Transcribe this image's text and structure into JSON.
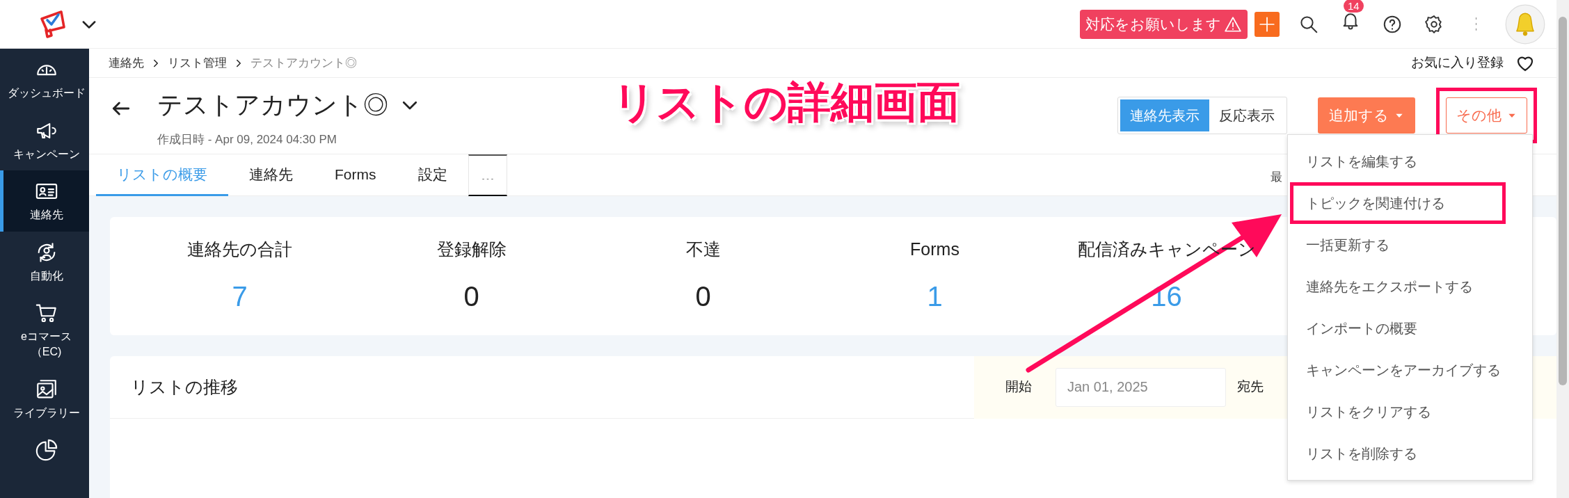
{
  "app_header": {
    "alert_button": "対応をお願いします",
    "notification_count": "14"
  },
  "sidebar": {
    "items": [
      {
        "label": "ダッシュボード",
        "kind": "gauge",
        "selected": false
      },
      {
        "label": "キャンペーン",
        "kind": "megaphone",
        "selected": false
      },
      {
        "label": "連絡先",
        "kind": "card",
        "selected": true
      },
      {
        "label": "自動化",
        "kind": "automation",
        "selected": false
      },
      {
        "label": "eコマース（EC)",
        "kind": "cart",
        "selected": false
      },
      {
        "label": "ライブラリー",
        "kind": "images",
        "selected": false
      },
      {
        "kind": "pie",
        "selected": false
      }
    ]
  },
  "breadcrumb": [
    {
      "label": "連絡先",
      "current": false
    },
    {
      "label": "リスト管理",
      "current": false
    },
    {
      "label": "テストアカウント◎",
      "current": true
    }
  ],
  "favorite": {
    "label": "お気に入り登録"
  },
  "page": {
    "title": "テストアカウント◎",
    "created": "作成日時 - Apr 09, 2024 04:30 PM"
  },
  "view_toggle": [
    {
      "label": "連絡先表示",
      "selected": true
    },
    {
      "label": "反応表示",
      "selected": false
    }
  ],
  "add_button": {
    "label": "追加する"
  },
  "more_button": {
    "label": "その他",
    "annotated": true
  },
  "tabs": [
    {
      "label": "リストの概要",
      "selected": true
    },
    {
      "label": "連絡先",
      "selected": false
    },
    {
      "label": "Forms",
      "selected": false
    },
    {
      "label": "設定",
      "selected": false
    }
  ],
  "tab_bar_note": "最",
  "stats": [
    {
      "label": "連絡先の合計",
      "value": "7",
      "link": true
    },
    {
      "label": "登録解除",
      "value": "0",
      "link": false
    },
    {
      "label": "不達",
      "value": "0",
      "link": false
    },
    {
      "label": "Forms",
      "value": "1",
      "link": true
    },
    {
      "label": "配信済みキャンペーン",
      "value": "16",
      "link": true
    }
  ],
  "trend": {
    "title": "リストの推移",
    "start_label": "開始",
    "start_value": "Jan 01, 2025",
    "end_label": "宛先"
  },
  "more_menu": {
    "items": [
      {
        "label": "リストを編集する",
        "highlighted": false
      },
      {
        "label": "トピックを関連付ける",
        "highlighted": true
      },
      {
        "label": "一括更新する",
        "highlighted": false
      },
      {
        "label": "連絡先をエクスポートする",
        "highlighted": false
      },
      {
        "label": "インポートの概要",
        "highlighted": false
      },
      {
        "label": "キャンペーンをアーカイブする",
        "highlighted": false
      },
      {
        "label": "リストをクリアする",
        "highlighted": false
      },
      {
        "label": "リストを削除する",
        "highlighted": false
      }
    ]
  },
  "annotation": {
    "title": "リストの詳細画面"
  }
}
